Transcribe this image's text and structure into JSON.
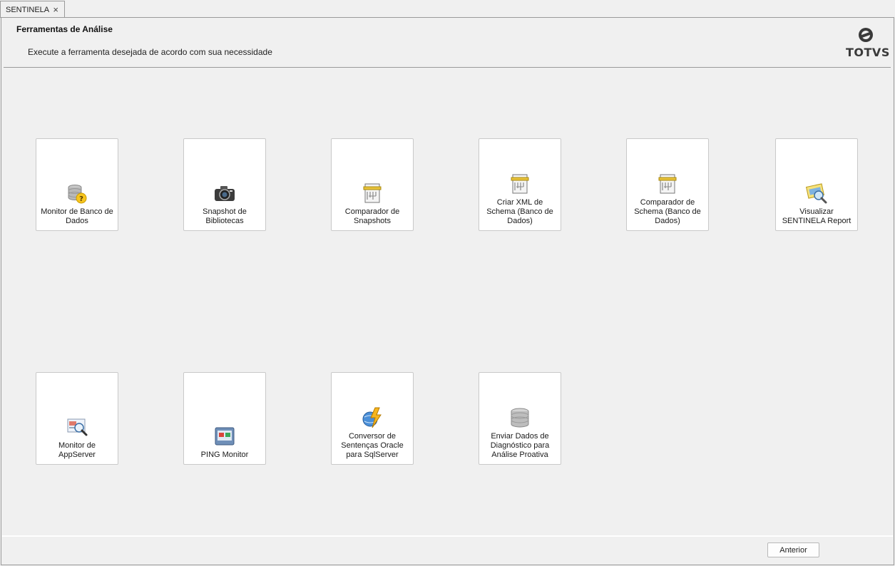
{
  "tab": {
    "label": "SENTINELA",
    "close_glyph": "×"
  },
  "header": {
    "title": "Ferramentas de Análise",
    "subtitle": "Execute a ferramenta desejada de acordo com sua necessidade",
    "logo_text": "TOTVS"
  },
  "tools": [
    {
      "label": "Monitor de Banco de Dados",
      "icon": "database-help-icon"
    },
    {
      "label": "Snapshot de Bibliotecas",
      "icon": "camera-icon"
    },
    {
      "label": "Comparador de Snapshots",
      "icon": "document-compare-icon"
    },
    {
      "label": "Criar XML de Schema (Banco de Dados)",
      "icon": "xml-schema-icon"
    },
    {
      "label": "Comparador de Schema (Banco de Dados)",
      "icon": "schema-compare-icon"
    },
    {
      "label": "Visualizar SENTINELA Report",
      "icon": "report-view-icon"
    },
    {
      "label": "Monitor de AppServer",
      "icon": "appserver-monitor-icon"
    },
    {
      "label": "PING Monitor",
      "icon": "ping-monitor-icon"
    },
    {
      "label": "Conversor de Sentenças Oracle para SqlServer",
      "icon": "converter-icon"
    },
    {
      "label": "Enviar Dados de Diagnóstico para Análise Proativa",
      "icon": "database-send-icon"
    }
  ],
  "footer": {
    "back_label": "Anterior"
  }
}
